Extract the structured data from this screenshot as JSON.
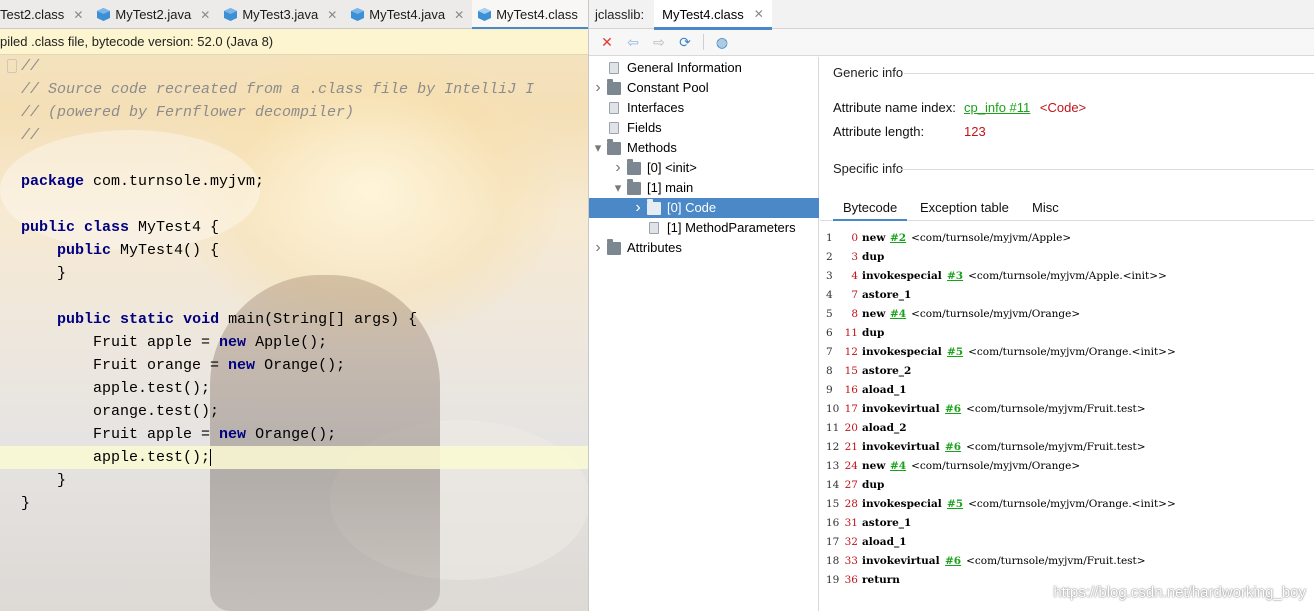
{
  "editor": {
    "tabs": [
      {
        "label": "Test2.class",
        "active": false,
        "icon": "class-file-icon"
      },
      {
        "label": "MyTest2.java",
        "active": false,
        "icon": "java-file-icon"
      },
      {
        "label": "MyTest3.java",
        "active": false,
        "icon": "java-file-icon"
      },
      {
        "label": "MyTest4.java",
        "active": false,
        "icon": "java-file-icon"
      },
      {
        "label": "MyTest4.class",
        "active": true,
        "icon": "class-file-icon"
      }
    ],
    "banner": "piled .class file, bytecode version: 52.0 (Java 8)",
    "code_lines": [
      "//",
      "// Source code recreated from a .class file by IntelliJ I",
      "// (powered by Fernflower decompiler)",
      "//",
      "",
      "package com.turnsole.myjvm;",
      "",
      "public class MyTest4 {",
      "    public MyTest4() {",
      "    }",
      "",
      "    public static void main(String[] args) {",
      "        Fruit apple = new Apple();",
      "        Fruit orange = new Orange();",
      "        apple.test();",
      "        orange.test();",
      "        Fruit apple = new Orange();",
      "        apple.test();",
      "    }",
      "}"
    ]
  },
  "jclasslib": {
    "panel_label": "jclasslib:",
    "tab_label": "MyTest4.class",
    "accent": "#4a88c7",
    "tree": [
      {
        "label": "General Information",
        "level": 0,
        "kind": "doc",
        "arrow": ""
      },
      {
        "label": "Constant Pool",
        "level": 0,
        "kind": "folder",
        "arrow": ">"
      },
      {
        "label": "Interfaces",
        "level": 0,
        "kind": "doc",
        "arrow": ""
      },
      {
        "label": "Fields",
        "level": 0,
        "kind": "doc",
        "arrow": ""
      },
      {
        "label": "Methods",
        "level": 0,
        "kind": "folder",
        "arrow": "v"
      },
      {
        "label": "[0] <init>",
        "level": 1,
        "kind": "folder",
        "arrow": ">"
      },
      {
        "label": "[1] main",
        "level": 1,
        "kind": "folder",
        "arrow": "v"
      },
      {
        "label": "[0] Code",
        "level": 2,
        "kind": "folder",
        "arrow": ">",
        "selected": true
      },
      {
        "label": "[1] MethodParameters",
        "level": 2,
        "kind": "doc",
        "arrow": ""
      },
      {
        "label": "Attributes",
        "level": 0,
        "kind": "folder",
        "arrow": ">"
      }
    ],
    "generic_info_title": "Generic info",
    "attr_name_index_label": "Attribute name index:",
    "attr_name_index_link": "cp_info #11",
    "attr_name_index_value": "<Code>",
    "attr_length_label": "Attribute length:",
    "attr_length_value": "123",
    "specific_info_title": "Specific info",
    "code_tabs": [
      "Bytecode",
      "Exception table",
      "Misc"
    ],
    "bytecode": [
      {
        "line": "1",
        "offset": "0",
        "op": "new",
        "ref": "#2",
        "comment": "<com/turnsole/myjvm/Apple>"
      },
      {
        "line": "2",
        "offset": "3",
        "op": "dup",
        "ref": "",
        "comment": ""
      },
      {
        "line": "3",
        "offset": "4",
        "op": "invokespecial",
        "ref": "#3",
        "comment": "<com/turnsole/myjvm/Apple.<init>>"
      },
      {
        "line": "4",
        "offset": "7",
        "op": "astore_1",
        "ref": "",
        "comment": ""
      },
      {
        "line": "5",
        "offset": "8",
        "op": "new",
        "ref": "#4",
        "comment": "<com/turnsole/myjvm/Orange>"
      },
      {
        "line": "6",
        "offset": "11",
        "op": "dup",
        "ref": "",
        "comment": ""
      },
      {
        "line": "7",
        "offset": "12",
        "op": "invokespecial",
        "ref": "#5",
        "comment": "<com/turnsole/myjvm/Orange.<init>>"
      },
      {
        "line": "8",
        "offset": "15",
        "op": "astore_2",
        "ref": "",
        "comment": ""
      },
      {
        "line": "9",
        "offset": "16",
        "op": "aload_1",
        "ref": "",
        "comment": ""
      },
      {
        "line": "10",
        "offset": "17",
        "op": "invokevirtual",
        "ref": "#6",
        "comment": "<com/turnsole/myjvm/Fruit.test>"
      },
      {
        "line": "11",
        "offset": "20",
        "op": "aload_2",
        "ref": "",
        "comment": ""
      },
      {
        "line": "12",
        "offset": "21",
        "op": "invokevirtual",
        "ref": "#6",
        "comment": "<com/turnsole/myjvm/Fruit.test>"
      },
      {
        "line": "13",
        "offset": "24",
        "op": "new",
        "ref": "#4",
        "comment": "<com/turnsole/myjvm/Orange>"
      },
      {
        "line": "14",
        "offset": "27",
        "op": "dup",
        "ref": "",
        "comment": ""
      },
      {
        "line": "15",
        "offset": "28",
        "op": "invokespecial",
        "ref": "#5",
        "comment": "<com/turnsole/myjvm/Orange.<init>>"
      },
      {
        "line": "16",
        "offset": "31",
        "op": "astore_1",
        "ref": "",
        "comment": ""
      },
      {
        "line": "17",
        "offset": "32",
        "op": "aload_1",
        "ref": "",
        "comment": ""
      },
      {
        "line": "18",
        "offset": "33",
        "op": "invokevirtual",
        "ref": "#6",
        "comment": "<com/turnsole/myjvm/Fruit.test>"
      },
      {
        "line": "19",
        "offset": "36",
        "op": "return",
        "ref": "",
        "comment": ""
      }
    ]
  },
  "watermark": "https://blog.csdn.net/hardworking_boy"
}
